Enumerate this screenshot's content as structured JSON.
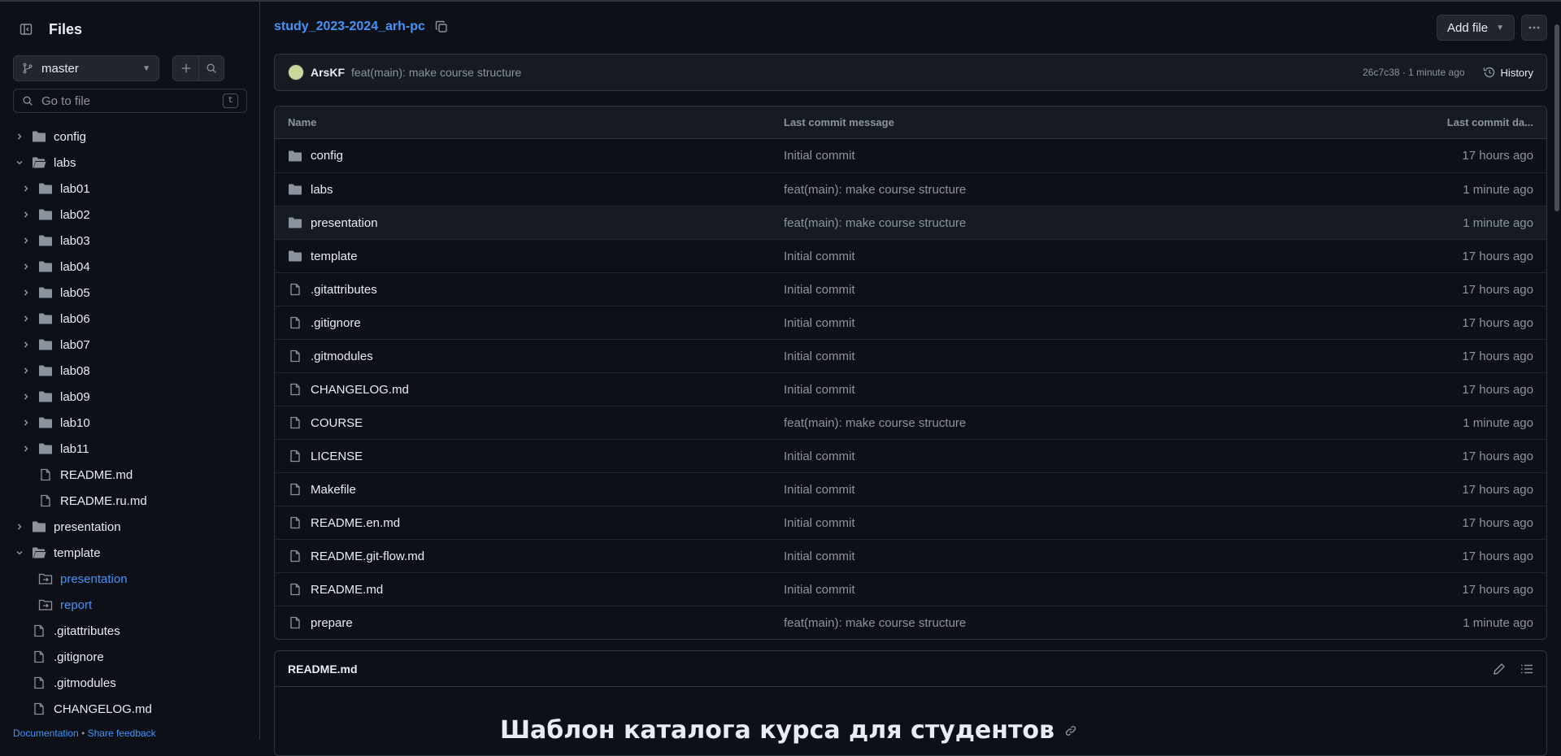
{
  "sidebar": {
    "title": "Files",
    "branch": "master",
    "goto_placeholder": "Go to file",
    "goto_shortcut": "t",
    "tree": [
      {
        "label": "config",
        "type": "folder",
        "depth": 0,
        "expanded": false
      },
      {
        "label": "labs",
        "type": "folder-open",
        "depth": 0,
        "expanded": true
      },
      {
        "label": "lab01",
        "type": "folder",
        "depth": 1,
        "expanded": false
      },
      {
        "label": "lab02",
        "type": "folder",
        "depth": 1,
        "expanded": false
      },
      {
        "label": "lab03",
        "type": "folder",
        "depth": 1,
        "expanded": false
      },
      {
        "label": "lab04",
        "type": "folder",
        "depth": 1,
        "expanded": false
      },
      {
        "label": "lab05",
        "type": "folder",
        "depth": 1,
        "expanded": false
      },
      {
        "label": "lab06",
        "type": "folder",
        "depth": 1,
        "expanded": false
      },
      {
        "label": "lab07",
        "type": "folder",
        "depth": 1,
        "expanded": false
      },
      {
        "label": "lab08",
        "type": "folder",
        "depth": 1,
        "expanded": false
      },
      {
        "label": "lab09",
        "type": "folder",
        "depth": 1,
        "expanded": false
      },
      {
        "label": "lab10",
        "type": "folder",
        "depth": 1,
        "expanded": false
      },
      {
        "label": "lab11",
        "type": "folder",
        "depth": 1,
        "expanded": false
      },
      {
        "label": "README.md",
        "type": "file",
        "depth": 1
      },
      {
        "label": "README.ru.md",
        "type": "file",
        "depth": 1
      },
      {
        "label": "presentation",
        "type": "folder",
        "depth": 0,
        "expanded": false
      },
      {
        "label": "template",
        "type": "folder-open",
        "depth": 0,
        "expanded": true
      },
      {
        "label": "presentation",
        "type": "submodule",
        "depth": 1
      },
      {
        "label": "report",
        "type": "submodule",
        "depth": 1
      },
      {
        "label": ".gitattributes",
        "type": "file",
        "depth": 0
      },
      {
        "label": ".gitignore",
        "type": "file",
        "depth": 0
      },
      {
        "label": ".gitmodules",
        "type": "file",
        "depth": 0
      },
      {
        "label": "CHANGELOG.md",
        "type": "file",
        "depth": 0
      }
    ],
    "footer": {
      "documentation": "Documentation",
      "separator": "•",
      "feedback": "Share feedback"
    }
  },
  "header": {
    "repo_name": "study_2023-2024_arh-pc",
    "add_file_label": "Add file"
  },
  "commit": {
    "author": "ArsKF",
    "message": "feat(main): make course structure",
    "sha_time": "26c7c38 · 1 minute ago",
    "history_label": "History"
  },
  "table": {
    "headers": {
      "name": "Name",
      "message": "Last commit message",
      "date": "Last commit da..."
    },
    "rows": [
      {
        "name": "config",
        "type": "folder",
        "message": "Initial commit",
        "date": "17 hours ago"
      },
      {
        "name": "labs",
        "type": "folder",
        "message": "feat(main): make course structure",
        "date": "1 minute ago"
      },
      {
        "name": "presentation",
        "type": "folder",
        "message": "feat(main): make course structure",
        "date": "1 minute ago"
      },
      {
        "name": "template",
        "type": "folder",
        "message": "Initial commit",
        "date": "17 hours ago"
      },
      {
        "name": ".gitattributes",
        "type": "file",
        "message": "Initial commit",
        "date": "17 hours ago"
      },
      {
        "name": ".gitignore",
        "type": "file",
        "message": "Initial commit",
        "date": "17 hours ago"
      },
      {
        "name": ".gitmodules",
        "type": "file",
        "message": "Initial commit",
        "date": "17 hours ago"
      },
      {
        "name": "CHANGELOG.md",
        "type": "file",
        "message": "Initial commit",
        "date": "17 hours ago"
      },
      {
        "name": "COURSE",
        "type": "file",
        "message": "feat(main): make course structure",
        "date": "1 minute ago"
      },
      {
        "name": "LICENSE",
        "type": "file",
        "message": "Initial commit",
        "date": "17 hours ago"
      },
      {
        "name": "Makefile",
        "type": "file",
        "message": "Initial commit",
        "date": "17 hours ago"
      },
      {
        "name": "README.en.md",
        "type": "file",
        "message": "Initial commit",
        "date": "17 hours ago"
      },
      {
        "name": "README.git-flow.md",
        "type": "file",
        "message": "Initial commit",
        "date": "17 hours ago"
      },
      {
        "name": "README.md",
        "type": "file",
        "message": "Initial commit",
        "date": "17 hours ago"
      },
      {
        "name": "prepare",
        "type": "file",
        "message": "feat(main): make course structure",
        "date": "1 minute ago"
      }
    ]
  },
  "readme": {
    "filename": "README.md",
    "heading": "Шаблон каталога курса для студентов"
  },
  "colors": {
    "background": "#0d1117",
    "accent": "#4493f8",
    "border": "#30363d",
    "muted": "#8b949e"
  }
}
